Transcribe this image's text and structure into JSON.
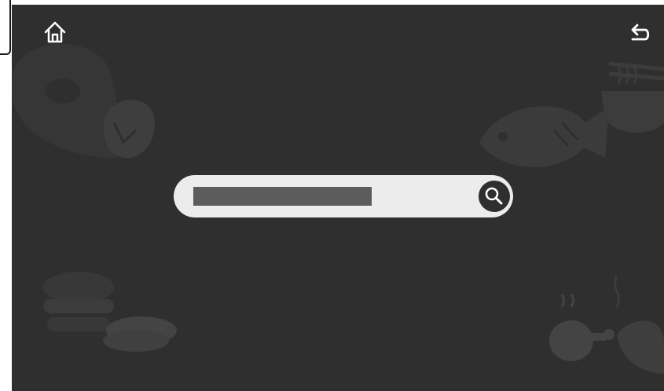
{
  "colors": {
    "screen_background": "#2f2f2f",
    "decor_art": "#3b3b3b",
    "search_bar": "#ececec",
    "search_field": "#5c5c5c",
    "icon": "#ffffff"
  },
  "icons": {
    "home": "home-icon",
    "back": "back-arrow-icon",
    "search": "search-icon"
  },
  "search": {
    "value": "",
    "placeholder": ""
  },
  "background_art": [
    "steak-icon",
    "ramen-bowl-icon",
    "fish-icon",
    "burger-icon",
    "sushi-icon",
    "chicken-leg-icon"
  ]
}
